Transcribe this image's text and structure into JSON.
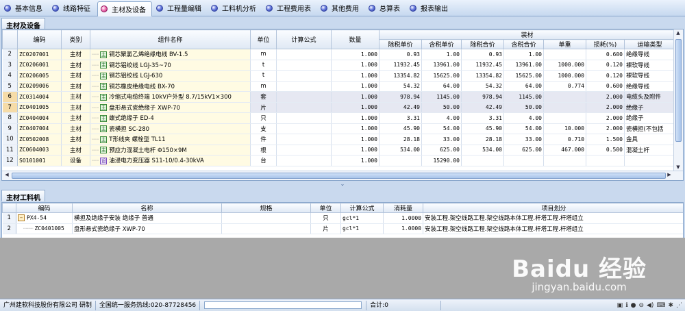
{
  "tabs": [
    {
      "label": "基本信息",
      "active": false
    },
    {
      "label": "线路特征",
      "active": false
    },
    {
      "label": "主材及设备",
      "active": true
    },
    {
      "label": "工程量编辑",
      "active": false
    },
    {
      "label": "工料机分析",
      "active": false
    },
    {
      "label": "工程费用表",
      "active": false
    },
    {
      "label": "其他费用",
      "active": false
    },
    {
      "label": "总算表",
      "active": false
    },
    {
      "label": "报表输出",
      "active": false
    }
  ],
  "top_panel": {
    "title": "主材及设备",
    "headers": {
      "code": "编码",
      "category": "类别",
      "name": "组件名称",
      "unit": "单位",
      "formula": "计算公式",
      "qty": "数量",
      "group": "装材",
      "notax_price": "除税单价",
      "tax_price": "含税单价",
      "notax_total": "除税合价",
      "tax_total": "含税合价",
      "unit_weight": "单重",
      "loss": "损耗(%)",
      "transport": "运输类型"
    },
    "rows": [
      {
        "n": "2",
        "code": "ZC0207001",
        "cat": "主材",
        "icon": "主",
        "name": "铜芯聚氯乙烯绝缘电线 BV-1.5",
        "unit": "m",
        "formula": "",
        "qty": "1.000",
        "p1": "0.93",
        "p2": "1.00",
        "p3": "0.93",
        "p4": "1.00",
        "w": "",
        "loss": "0.600",
        "trans": "绝缘导线"
      },
      {
        "n": "3",
        "code": "ZC0206001",
        "cat": "主材",
        "icon": "主",
        "name": "钢芯铝绞线 LGJ-35~70",
        "unit": "t",
        "formula": "",
        "qty": "1.000",
        "p1": "11932.45",
        "p2": "13961.00",
        "p3": "11932.45",
        "p4": "13961.00",
        "w": "1000.000",
        "loss": "0.120",
        "trans": "裸软导线"
      },
      {
        "n": "4",
        "code": "ZC0206005",
        "cat": "主材",
        "icon": "主",
        "name": "钢芯铝绞线 LGJ-630",
        "unit": "t",
        "formula": "",
        "qty": "1.000",
        "p1": "13354.82",
        "p2": "15625.00",
        "p3": "13354.82",
        "p4": "15625.00",
        "w": "1000.000",
        "loss": "0.120",
        "trans": "裸软导线"
      },
      {
        "n": "5",
        "code": "ZC0209006",
        "cat": "主材",
        "icon": "主",
        "name": "铜芯橡皮绝缘电线 BX-70",
        "unit": "m",
        "formula": "",
        "qty": "1.000",
        "p1": "54.32",
        "p2": "64.00",
        "p3": "54.32",
        "p4": "64.00",
        "w": "0.774",
        "loss": "0.600",
        "trans": "绝缘导线"
      },
      {
        "n": "6",
        "code": "ZC0314004",
        "cat": "主材",
        "icon": "主",
        "name": "冷缩式电缆终端 10kV户外型 8.7/15kV1×300",
        "unit": "套",
        "formula": "",
        "qty": "1.000",
        "p1": "978.94",
        "p2": "1145.00",
        "p3": "978.94",
        "p4": "1145.00",
        "w": "",
        "loss": "2.000",
        "trans": "电缆头及附件"
      },
      {
        "n": "7",
        "code": "ZC0401005",
        "cat": "主材",
        "icon": "主",
        "name": "盘形悬式瓷绝缘子 XWP-70",
        "unit": "片",
        "formula": "",
        "qty": "1.000",
        "p1": "42.49",
        "p2": "50.00",
        "p3": "42.49",
        "p4": "50.00",
        "w": "",
        "loss": "2.000",
        "trans": "绝缘子"
      },
      {
        "n": "8",
        "code": "ZC0404004",
        "cat": "主材",
        "icon": "主",
        "name": "蝶式绝缘子 ED-4",
        "unit": "只",
        "formula": "",
        "qty": "1.000",
        "p1": "3.31",
        "p2": "4.00",
        "p3": "3.31",
        "p4": "4.00",
        "w": "",
        "loss": "2.000",
        "trans": "绝缘子"
      },
      {
        "n": "9",
        "code": "ZC0407004",
        "cat": "主材",
        "icon": "主",
        "name": "瓷横担 SC-280",
        "unit": "支",
        "formula": "",
        "qty": "1.000",
        "p1": "45.90",
        "p2": "54.00",
        "p3": "45.90",
        "p4": "54.00",
        "w": "10.000",
        "loss": "2.000",
        "trans": "瓷横担(不包括"
      },
      {
        "n": "10",
        "code": "ZC0502008",
        "cat": "主材",
        "icon": "主",
        "name": "T形线夹 螺栓型 TL11",
        "unit": "件",
        "formula": "",
        "qty": "1.000",
        "p1": "28.18",
        "p2": "33.00",
        "p3": "28.18",
        "p4": "33.00",
        "w": "0.710",
        "loss": "1.500",
        "trans": "金具"
      },
      {
        "n": "11",
        "code": "ZC0604003",
        "cat": "主材",
        "icon": "主",
        "name": "预应力混凝土电杆 Φ150×9M",
        "unit": "根",
        "formula": "",
        "qty": "1.000",
        "p1": "534.00",
        "p2": "625.00",
        "p3": "534.00",
        "p4": "625.00",
        "w": "467.000",
        "loss": "0.500",
        "trans": "混凝土杆"
      },
      {
        "n": "12",
        "code": "SO101001",
        "cat": "设备",
        "icon": "设",
        "name": "油浸电力变压器 S11-10/0.4-30kVA",
        "unit": "台",
        "formula": "",
        "qty": "1.000",
        "p1": "",
        "p2": "15290.00",
        "p3": "",
        "p4": "",
        "w": "",
        "loss": "",
        "trans": ""
      }
    ]
  },
  "bottom_panel": {
    "title": "主材工料机",
    "headers": {
      "code": "编码",
      "name": "名称",
      "spec": "规格",
      "unit": "单位",
      "formula": "计算公式",
      "consumption": "消耗量",
      "division": "项目划分"
    },
    "rows": [
      {
        "n": "1",
        "code": "PX4-54",
        "name": "横担及绝缘子安装 绝缘子 普通",
        "spec": "",
        "unit": "只",
        "formula": "gcl*1",
        "cons": "1.0000",
        "div": "安装工程.架空线路工程.架空线路本体工程.杆塔工程.杆塔组立"
      },
      {
        "n": "2",
        "code": "ZC0401005",
        "name": "盘形悬式瓷绝缘子 XWP-70",
        "spec": "",
        "unit": "片",
        "formula": "gcl*1",
        "cons": "1.0000",
        "div": "安装工程.架空线路工程.架空线路本体工程.杆塔工程.杆塔组立"
      }
    ]
  },
  "status": {
    "company": "广州建软科技股份有限公司 研制",
    "hotline": "全国统一服务热线:020-87728456",
    "total": "合计:0"
  },
  "watermark": {
    "big": "Baidu 经验",
    "small": "jingyan.baidu.com"
  }
}
